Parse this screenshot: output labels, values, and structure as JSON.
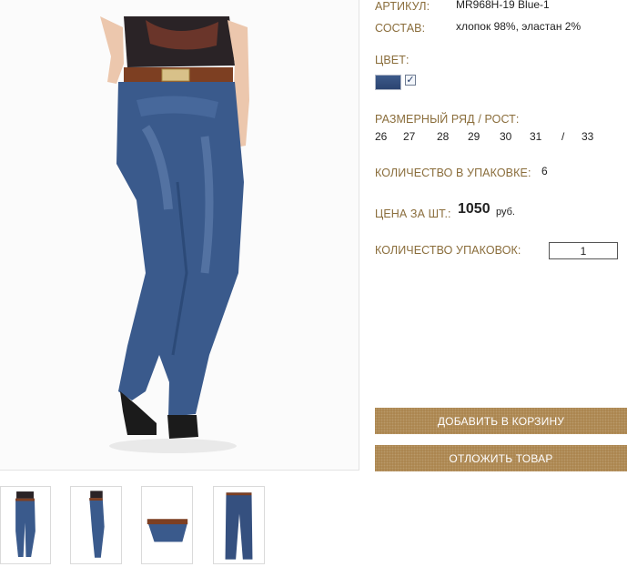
{
  "product": {
    "sku_label": "АРТИКУЛ:",
    "sku_value": "MR968H-19 Blue-1",
    "composition_label": "СОСТАВ:",
    "composition_value": "хлопок 98%, эластан 2%",
    "color_label": "ЦВЕТ:",
    "color_swatch": "#35507f",
    "color_checked": true,
    "size_label": "РАЗМЕРНЫЙ РЯД / РОСТ:",
    "sizes": [
      "26",
      "27",
      "28",
      "29",
      "30",
      "31",
      "/",
      "33"
    ],
    "pack_label": "КОЛИЧЕСТВО В УПАКОВКЕ:",
    "pack_value": "6",
    "price_label": "ЦЕНА ЗА ШТ.:",
    "price_value": "1050",
    "price_currency": "руб.",
    "qty_label": "КОЛИЧЕСТВО УПАКОВОК:",
    "qty_value": "1"
  },
  "buttons": {
    "add_to_cart": "ДОБАВИТЬ В КОРЗИНУ",
    "postpone": "ОТЛОЖИТЬ ТОВАР"
  },
  "colors": {
    "label": "#8a6d3b",
    "button": "#a9824a",
    "denim": "#35507f"
  },
  "thumbnails": [
    "front-view",
    "side-view",
    "waist-detail",
    "flat-view"
  ]
}
